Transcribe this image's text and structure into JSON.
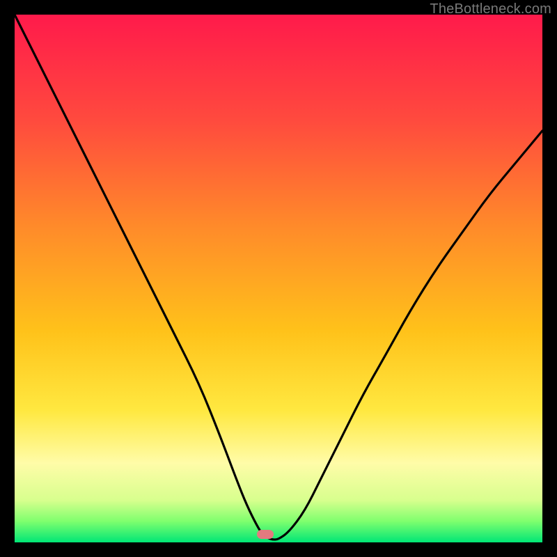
{
  "watermark": "TheBottleneck.com",
  "colors": {
    "frame_bg": "#000000",
    "curve_stroke": "#000000",
    "marker_fill": "#e37a7f",
    "gradient_top": "#ff1a4b",
    "gradient_bottom": "#00e676"
  },
  "marker": {
    "x_frac": 0.475,
    "y_frac": 0.985
  },
  "chart_data": {
    "type": "line",
    "title": "",
    "xlabel": "",
    "ylabel": "",
    "xlim": [
      0,
      100
    ],
    "ylim": [
      0,
      100
    ],
    "x": [
      0,
      5,
      10,
      15,
      20,
      25,
      30,
      35,
      39,
      42,
      44,
      46,
      47,
      48,
      49,
      50,
      52,
      55,
      58,
      62,
      66,
      70,
      75,
      80,
      85,
      90,
      95,
      100
    ],
    "values": [
      100,
      90,
      80,
      70,
      60,
      50,
      40,
      30,
      20,
      12,
      7,
      3,
      1.5,
      0.8,
      0.5,
      0.6,
      2,
      6,
      12,
      20,
      28,
      35,
      44,
      52,
      59,
      66,
      72,
      78
    ],
    "annotations": [
      {
        "type": "marker",
        "x": 47.5,
        "y": 1.5,
        "label": ""
      }
    ]
  }
}
